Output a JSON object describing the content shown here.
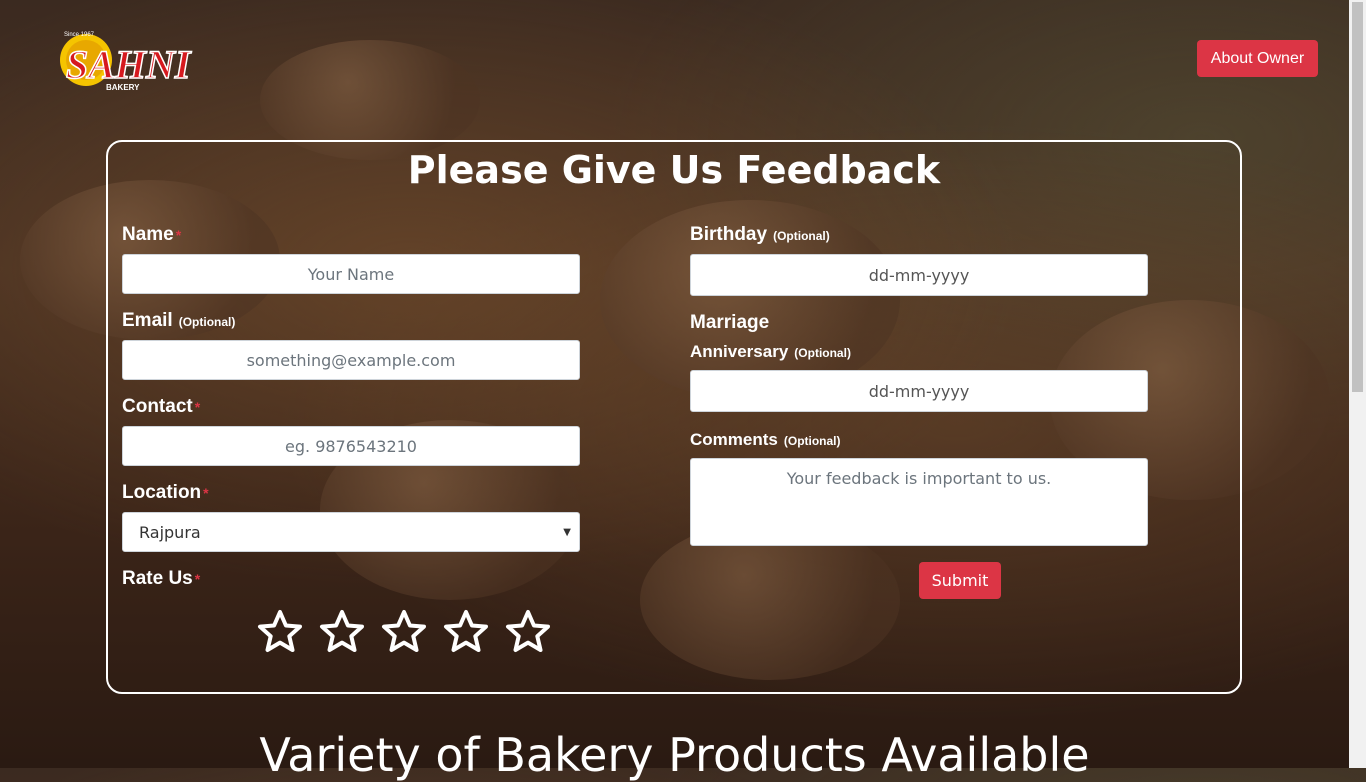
{
  "brand": {
    "logo_small_text": "Since 1967",
    "logo_text": "SAHNI",
    "logo_sub": "BAKERY"
  },
  "header": {
    "about_button": "About Owner"
  },
  "form": {
    "title": "Please Give Us Feedback",
    "name": {
      "label": "Name",
      "placeholder": "Your Name"
    },
    "email": {
      "label": "Email",
      "optional": "(Optional)",
      "placeholder": "something@example.com"
    },
    "contact": {
      "label": "Contact",
      "placeholder": "eg. 9876543210"
    },
    "location": {
      "label": "Location",
      "selected": "Rajpura"
    },
    "rate": {
      "label": "Rate Us",
      "value": 0,
      "max": 5
    },
    "birthday": {
      "label": "Birthday",
      "optional": "(Optional)",
      "placeholder": "dd-mm-yyyy"
    },
    "anniversary": {
      "label_line1": "Marriage",
      "label_line2": "Anniversary",
      "optional": "(Optional)",
      "placeholder": "dd-mm-yyyy"
    },
    "comments": {
      "label": "Comments",
      "optional": "(Optional)",
      "placeholder": "Your feedback is important to us."
    },
    "submit_label": "Submit",
    "required_mark": "*"
  },
  "sections": {
    "products_heading": "Variety of Bakery Products Available"
  },
  "icons": {
    "star": "star-outline-icon",
    "dropdown": "caret-down-icon"
  },
  "colors": {
    "accent": "#dc3545",
    "text": "#ffffff"
  }
}
